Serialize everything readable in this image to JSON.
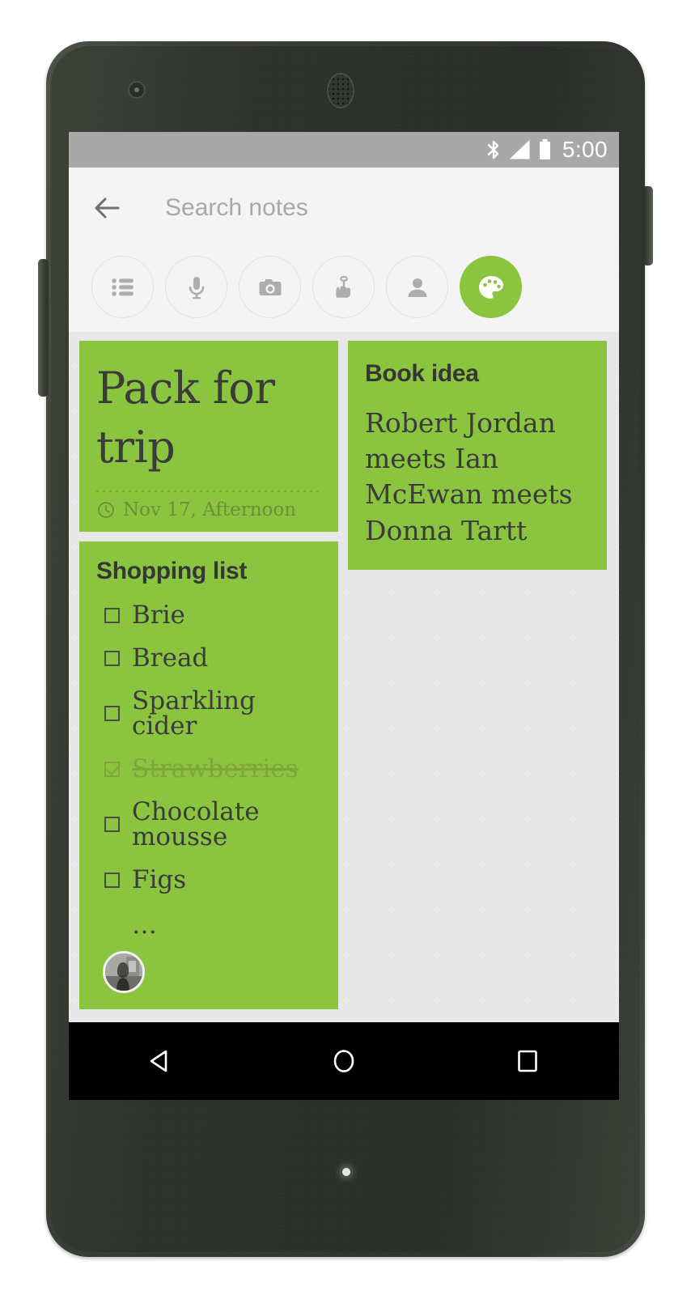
{
  "device": {
    "hardware": {
      "front_camera": "front-camera",
      "earpiece": "earpiece-speaker",
      "volume_rocker": "volume-rocker",
      "power_button": "power-button",
      "notification_led": "notification-led"
    },
    "nav_bar": {
      "back": "back",
      "home": "home",
      "recents": "recent-apps"
    }
  },
  "status_bar": {
    "time": "5:00",
    "icons": [
      "bluetooth-icon",
      "signal-icon",
      "battery-icon"
    ],
    "background": "#a8a8a8"
  },
  "app_bar": {
    "back_label": "back-arrow",
    "search": {
      "placeholder": "Search notes",
      "value": ""
    },
    "filters": [
      {
        "name": "list",
        "icon": "list-icon",
        "label": "Lists",
        "active": false
      },
      {
        "name": "audio",
        "icon": "mic-icon",
        "label": "Audio",
        "active": false
      },
      {
        "name": "images",
        "icon": "camera-icon",
        "label": "Images",
        "active": false
      },
      {
        "name": "reminders",
        "icon": "reminder-icon",
        "label": "Reminders",
        "active": false
      },
      {
        "name": "shared",
        "icon": "person-icon",
        "label": "Shared",
        "active": false
      },
      {
        "name": "colors",
        "icon": "palette-icon",
        "label": "Colors",
        "active": true
      }
    ]
  },
  "notes": {
    "background": "#e8e8e8",
    "card_color": "#8bc53f",
    "items": [
      {
        "id": "pack-for-trip",
        "kind": "big-title",
        "title": "Pack for trip",
        "reminder": {
          "icon": "clock-icon",
          "text": "Nov 17, Afternoon"
        }
      },
      {
        "id": "book-idea",
        "kind": "text",
        "title": "Book idea",
        "body": "Robert Jordan meets Ian McEwan meets Donna Tartt"
      },
      {
        "id": "shopping-list",
        "kind": "checklist",
        "title": "Shopping list",
        "checklist": [
          {
            "label": "Brie",
            "checked": false
          },
          {
            "label": "Bread",
            "checked": false
          },
          {
            "label": "Sparkling cider",
            "checked": false
          },
          {
            "label": "Strawberries",
            "checked": true
          },
          {
            "label": "Chocolate mousse",
            "checked": false
          },
          {
            "label": "Figs",
            "checked": false
          }
        ],
        "more_indicator": "…",
        "collaborator_avatar": "collaborator-avatar"
      }
    ]
  }
}
